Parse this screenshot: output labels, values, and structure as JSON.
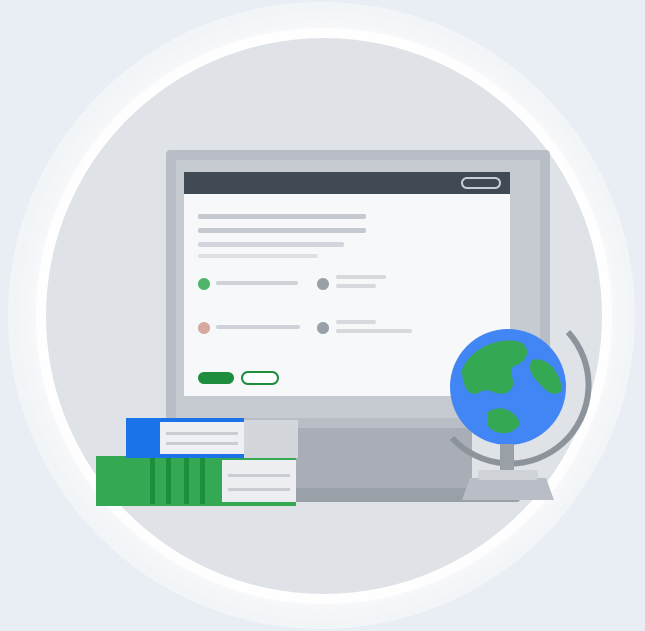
{
  "illustration": {
    "subject": "computer-with-quiz-books-and-globe",
    "icons": [
      "monitor-icon",
      "book-stack-icon",
      "globe-icon"
    ],
    "colors": {
      "background": "#e9eef4",
      "disc": "#dfe3e8",
      "monitor_frame": "#b9bec6",
      "monitor_bezel": "#3f4a55",
      "screen": "#f7f8f9",
      "accent_green": "#1e8e3e",
      "book_blue": "#1a73e8",
      "book_green": "#34a853",
      "globe_ocean": "#4285f4",
      "globe_land": "#34a853"
    },
    "quiz": {
      "options": [
        {
          "state": "correct"
        },
        {
          "state": "neutral"
        },
        {
          "state": "incorrect"
        },
        {
          "state": "neutral"
        }
      ],
      "buttons": [
        {
          "style": "filled"
        },
        {
          "style": "outlined"
        }
      ]
    }
  }
}
